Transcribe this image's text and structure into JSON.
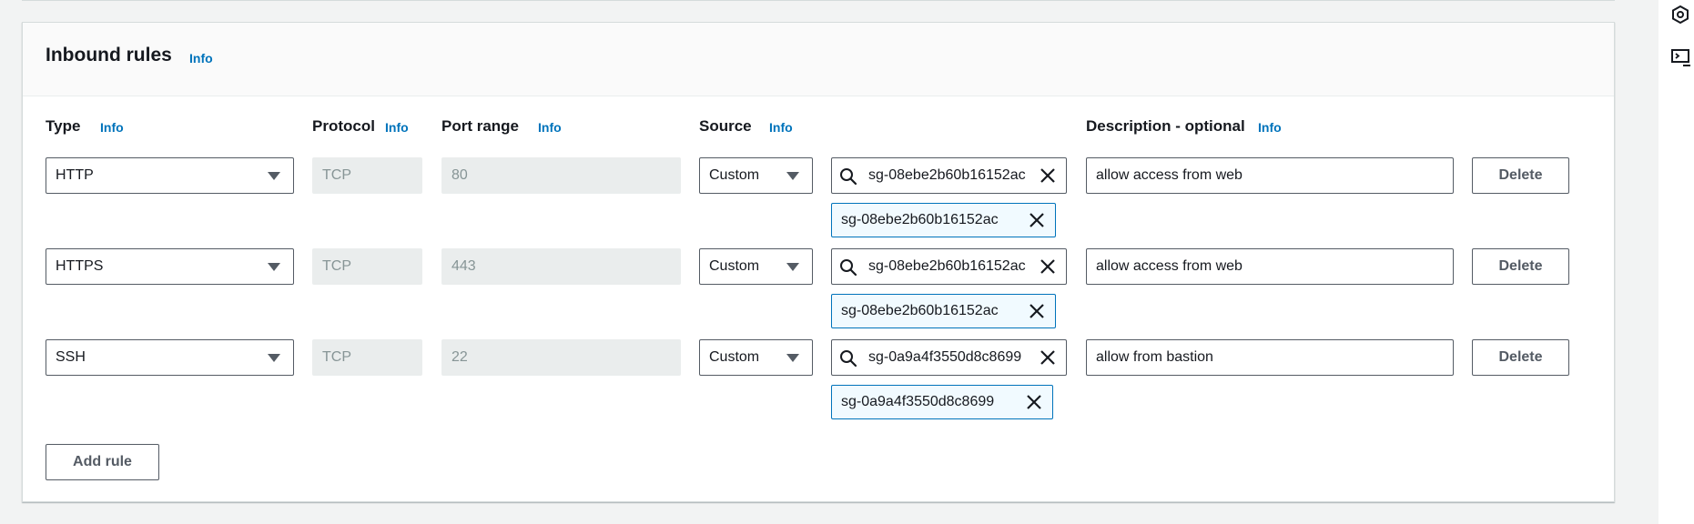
{
  "panel": {
    "title": "Inbound rules",
    "title_info": "Info"
  },
  "columns": {
    "type": {
      "label": "Type",
      "info": "Info"
    },
    "protocol": {
      "label": "Protocol",
      "info": "Info"
    },
    "port_range": {
      "label": "Port range",
      "info": "Info"
    },
    "source": {
      "label": "Source",
      "info": "Info"
    },
    "description": {
      "label": "Description - optional",
      "info": "Info"
    }
  },
  "rules": [
    {
      "type": "HTTP",
      "protocol": "TCP",
      "port_range": "80",
      "source_type": "Custom",
      "source_search": "sg-08ebe2b60b16152ac",
      "source_token": "sg-08ebe2b60b16152ac",
      "description": "allow access from web",
      "delete_label": "Delete"
    },
    {
      "type": "HTTPS",
      "protocol": "TCP",
      "port_range": "443",
      "source_type": "Custom",
      "source_search": "sg-08ebe2b60b16152ac",
      "source_token": "sg-08ebe2b60b16152ac",
      "description": "allow access from web",
      "delete_label": "Delete"
    },
    {
      "type": "SSH",
      "protocol": "TCP",
      "port_range": "22",
      "source_type": "Custom",
      "source_search": "sg-0a9a4f3550d8c8699",
      "source_token": "sg-0a9a4f3550d8c8699",
      "description": "allow from bastion",
      "delete_label": "Delete"
    }
  ],
  "add_rule_label": "Add rule",
  "icons": {
    "search": "search-icon",
    "remove": "close-icon",
    "dropdown": "caret-down-icon",
    "rail_top": "hexagon-icon",
    "rail_bottom": "cloudshell-icon"
  },
  "colors": {
    "link": "#0073bb",
    "token_bg": "#f1faff",
    "disabled_bg": "#eaeded",
    "page_bg": "#f2f3f3"
  }
}
